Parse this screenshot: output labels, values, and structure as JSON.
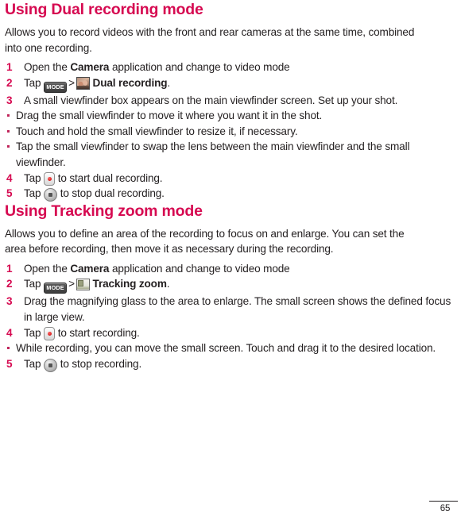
{
  "page": {
    "number": "65"
  },
  "sections": [
    {
      "title": "Using Dual recording mode",
      "intro": "Allows you to record videos with the front and rear cameras at the same time, combined into one recording.",
      "items": [
        {
          "marker": "1",
          "type": "number",
          "text_before": "Open the ",
          "bold": "Camera",
          "text_after": " application and change to video mode"
        },
        {
          "marker": "2",
          "type": "number",
          "tap_label": "Tap",
          "mode_icon_label": "MODE",
          "separator": ">",
          "icon": "dual-recording-thumbnail",
          "bold": "Dual recording",
          "text_after": "."
        },
        {
          "marker": "3",
          "type": "number",
          "text": "A small viewfinder box appears on the main viewfinder screen. Set up your shot."
        },
        {
          "marker": "•",
          "type": "bullet",
          "text": "Drag the small viewfinder to move it where you want it in the shot."
        },
        {
          "marker": "•",
          "type": "bullet",
          "text": "Touch and hold the small viewfinder to resize it, if necessary."
        },
        {
          "marker": "•",
          "type": "bullet",
          "text": "Tap the small viewfinder to swap the lens between the main viewfinder and the small viewfinder."
        },
        {
          "marker": "4",
          "type": "number",
          "tap_label": "Tap",
          "icon": "record-button",
          "text_after": " to start dual recording."
        },
        {
          "marker": "5",
          "type": "number",
          "tap_label": "Tap",
          "icon": "stop-button",
          "text_after": " to stop dual recording."
        }
      ]
    },
    {
      "title": "Using Tracking zoom mode",
      "intro": "Allows you to define an area of the recording to focus on and enlarge. You can set the area before recording, then move it as necessary during the recording.",
      "items": [
        {
          "marker": "1",
          "type": "number",
          "text_before": "Open the ",
          "bold": "Camera",
          "text_after": " application and change to video mode"
        },
        {
          "marker": "2",
          "type": "number",
          "tap_label": "Tap",
          "mode_icon_label": "MODE",
          "separator": ">",
          "icon": "tracking-zoom-thumbnail",
          "bold": "Tracking zoom",
          "text_after": "."
        },
        {
          "marker": "3",
          "type": "number",
          "text": "Drag the magnifying glass to the area to enlarge. The small screen shows the defined focus in large view."
        },
        {
          "marker": "4",
          "type": "number",
          "tap_label": "Tap",
          "icon": "record-button",
          "text_after": " to start recording."
        },
        {
          "marker": "•",
          "type": "bullet",
          "text": "While recording, you can move the small screen. Touch and drag it to the desired location."
        },
        {
          "marker": "5",
          "type": "number",
          "tap_label": "Tap",
          "icon": "stop-button",
          "text_after": " to stop recording."
        }
      ]
    }
  ]
}
